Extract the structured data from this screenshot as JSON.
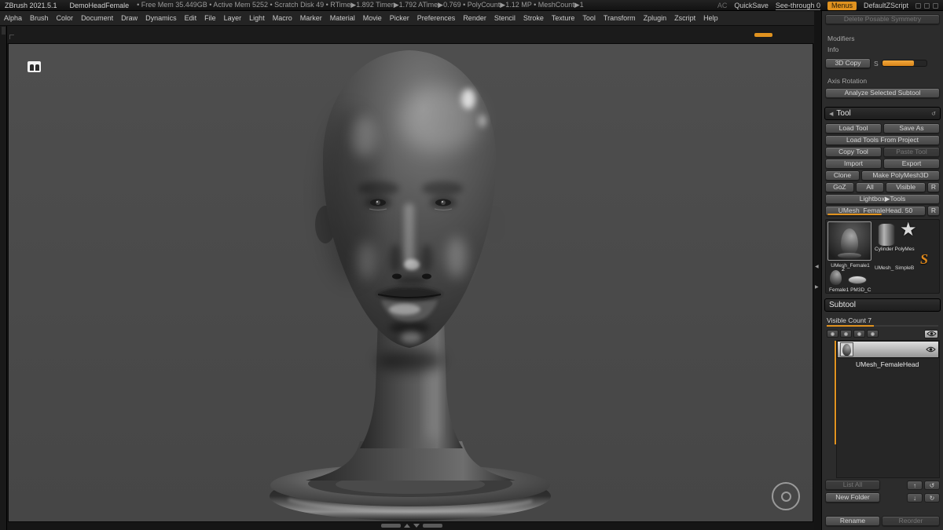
{
  "colors": {
    "accent_orange": "#e0921f",
    "canvas_gray": "#4a4a4a",
    "panel_bg": "#2c2c2c"
  },
  "title_bar": {
    "app_name": "ZBrush 2021.5.1",
    "doc_name": "DemoHeadFemale",
    "stats": "• Free Mem 35.449GB • Active Mem 5252 • Scratch Disk 49 • RTime▶1.892 Timer▶1.792 ATime▶0.769 • PolyCount▶1.12 MP • MeshCount▶1",
    "ac": "AC",
    "quicksave": "QuickSave",
    "see_through": "See-through 0",
    "menus": "Menus",
    "zscript": "DefaultZScript"
  },
  "menu_bar": {
    "items": [
      "Alpha",
      "Brush",
      "Color",
      "Document",
      "Draw",
      "Dynamics",
      "Edit",
      "File",
      "Layer",
      "Light",
      "Macro",
      "Marker",
      "Material",
      "Movie",
      "Picker",
      "Preferences",
      "Render",
      "Stencil",
      "Stroke",
      "Texture",
      "Tool",
      "Transform",
      "Zplugin",
      "Zscript",
      "Help"
    ]
  },
  "panel": {
    "delete_posable": "Delete Posable Symmetry",
    "modifiers": "Modifiers",
    "info": "Info",
    "copy3d": "3D Copy",
    "s": "S",
    "axis_rotation": "Axis Rotation",
    "analyze": "Analyze Selected Subtool",
    "tool": {
      "title": "Tool",
      "load_tool": "Load Tool",
      "save_as": "Save As",
      "load_project": "Load Tools From Project",
      "copy_tool": "Copy Tool",
      "paste_tool": "Paste Tool",
      "import": "Import",
      "export": "Export",
      "clone": "Clone",
      "make_polymesh": "Make PolyMesh3D",
      "goz": "GoZ",
      "all": "All",
      "visible": "Visible",
      "r": "R",
      "lightbox": "Lightbox▶Tools",
      "active": "UMesh_FemaleHead. 50",
      "thumbs": {
        "female1": "UMesh_Female1",
        "cylinder": "Cylinder PolyMes",
        "simpleb": "UMesh_ SimpleB",
        "pm3d": "Female1 PM3D_C",
        "badge": "2"
      }
    },
    "subtool": {
      "title": "Subtool",
      "visible_count": "Visible Count 7",
      "item_name": "UMesh_FemaleHead",
      "list_all": "List All",
      "new_folder": "New Folder",
      "rename": "Rename",
      "reorder": "Reorder"
    }
  },
  "icons": {
    "left_arrow": "◀",
    "right_arrow": "▶",
    "up_arrow": "↑",
    "down_arrow": "↓",
    "ccw_arrow": "↺",
    "cw_arrow": "↻",
    "star": "★",
    "s_logo": "S"
  }
}
